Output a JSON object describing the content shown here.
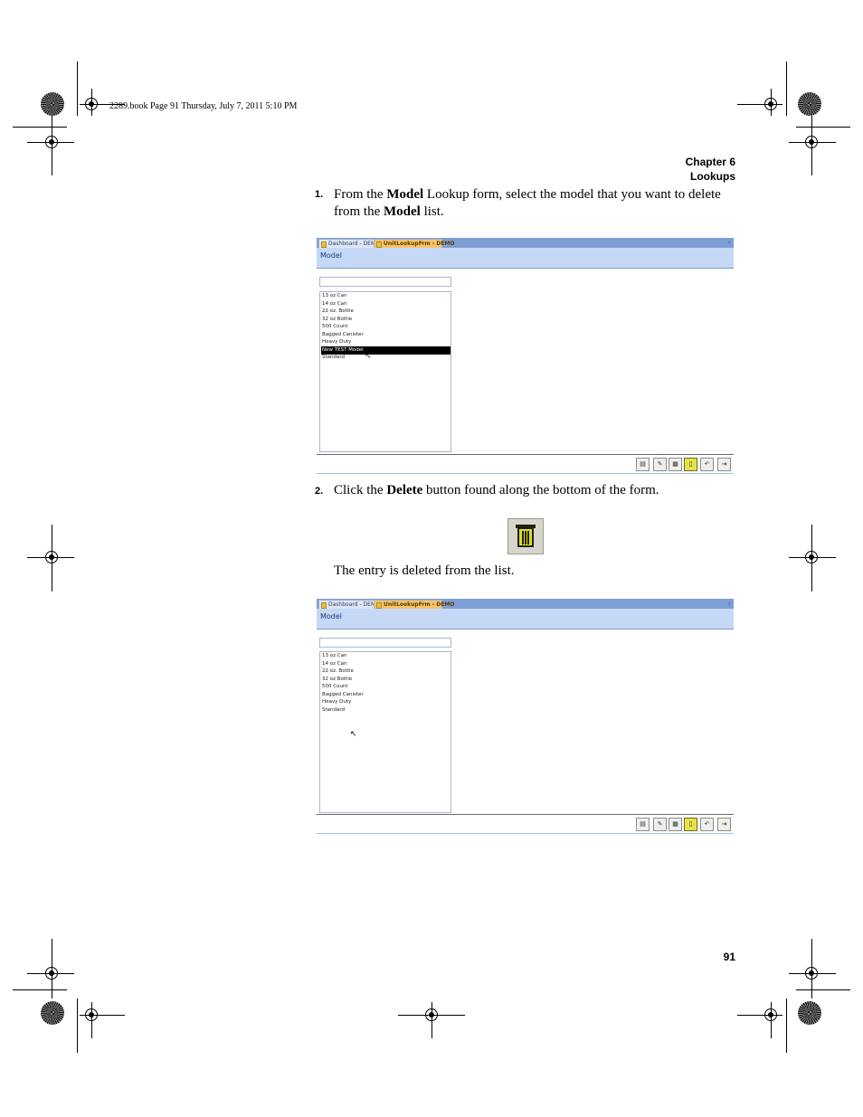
{
  "slug_line": "2289.book  Page 91  Thursday, July 7, 2011  5:10 PM",
  "header": {
    "chapter": "Chapter 6",
    "section": "Lookups"
  },
  "steps": [
    {
      "number": "1.",
      "parts": [
        "From the ",
        "Model",
        " Lookup form, select the model that you want to delete",
        "from the ",
        "Model",
        " list."
      ]
    },
    {
      "number": "2.",
      "parts": [
        "Click the ",
        "Delete",
        " button found along the bottom of the form."
      ]
    }
  ],
  "result_text": "The entry is deleted from the list.",
  "screenshots": [
    {
      "tabs": [
        "Dashboard - DEMO",
        "UnitLookupFrm - DEMO"
      ],
      "close_glyph": "x",
      "form_title": "Model",
      "search_value": "",
      "list_items": [
        "13 oz Can",
        "14 oz Can",
        "22 oz. Bottle",
        "32 oz Bottle",
        "500 Count",
        "Bagged Canister",
        "Heavy Duty",
        "New TEST Model",
        "Standard"
      ],
      "selected_item": "New TEST Model"
    },
    {
      "tabs": [
        "Dashboard - DEMO",
        "UnitLookupFrm - DEMO"
      ],
      "close_glyph": "x",
      "form_title": "Model",
      "search_value": "",
      "list_items": [
        "13 oz Can",
        "14 oz Can",
        "22 oz. Bottle",
        "32 oz Bottle",
        "500 Count",
        "Bagged Canister",
        "Heavy Duty",
        "Standard"
      ],
      "selected_item": ""
    }
  ],
  "toolbar_icons": [
    "new-icon",
    "edit-icon",
    "save-icon",
    "delete-icon",
    "undo-icon",
    "exit-icon"
  ],
  "delete_button_icon": "trash-can-icon",
  "page_number": "91"
}
